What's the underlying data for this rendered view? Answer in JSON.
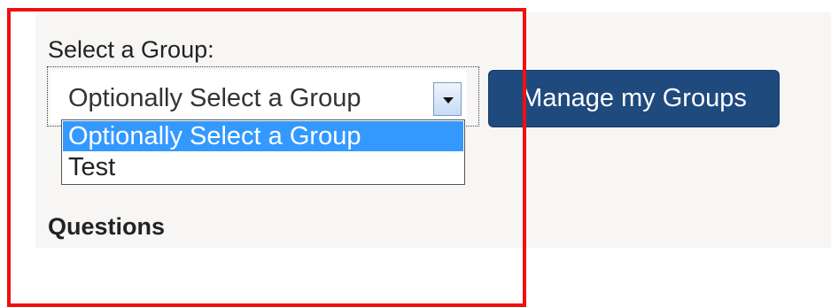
{
  "group_selector": {
    "label": "Select a Group:",
    "selected_value": "Optionally Select a Group",
    "options": [
      "Optionally Select a Group",
      "Test"
    ]
  },
  "manage_groups_button": {
    "label": "Manage my Groups"
  },
  "questions": {
    "heading": "Questions"
  },
  "colors": {
    "button_bg": "#1f4a7e",
    "option_highlight": "#3399ff",
    "panel_bg": "#f7f6f5",
    "annotation_frame": "#ee1111"
  }
}
